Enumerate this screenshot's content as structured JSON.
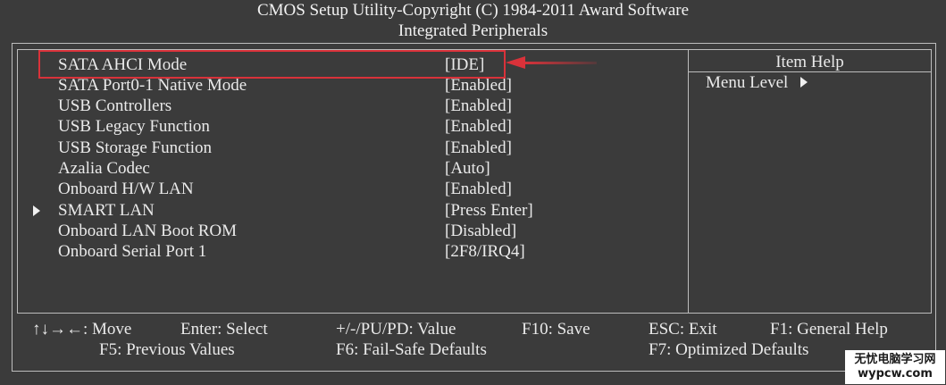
{
  "header": {
    "title_line1": "CMOS Setup Utility-Copyright (C) 1984-2011 Award Software",
    "title_line2": "Integrated Peripherals"
  },
  "settings": [
    {
      "label": "SATA AHCI Mode",
      "value": "[IDE]",
      "submenu": false,
      "highlighted": true
    },
    {
      "label": "SATA Port0-1 Native Mode",
      "value": "[Enabled]",
      "submenu": false
    },
    {
      "label": "USB Controllers",
      "value": "[Enabled]",
      "submenu": false
    },
    {
      "label": "USB Legacy Function",
      "value": "[Enabled]",
      "submenu": false
    },
    {
      "label": "USB Storage Function",
      "value": "[Enabled]",
      "submenu": false
    },
    {
      "label": "Azalia Codec",
      "value": "[Auto]",
      "submenu": false
    },
    {
      "label": "Onboard H/W LAN",
      "value": "[Enabled]",
      "submenu": false
    },
    {
      "label": "SMART LAN",
      "value": "[Press Enter]",
      "submenu": true
    },
    {
      "label": "Onboard LAN Boot ROM",
      "value": "[Disabled]",
      "submenu": false
    },
    {
      "label": "Onboard Serial Port 1",
      "value": "[2F8/IRQ4]",
      "submenu": false
    }
  ],
  "help_panel": {
    "title": "Item Help",
    "menu_level_label": "Menu Level",
    "menu_level_icon": "triangle-right-icon"
  },
  "footer": {
    "move_icon": "↑↓→←",
    "move": ": Move",
    "enter": "Enter: Select",
    "value": "+/-/PU/PD: Value",
    "save": "F10: Save",
    "exit": "ESC: Exit",
    "help": "F1: General Help",
    "previous": "F5: Previous Values",
    "failsafe": "F6: Fail-Safe Defaults",
    "optimized": "F7: Optimized Defaults"
  },
  "watermark": {
    "text": "无忧电脑学习网",
    "url": "wypcw.com"
  },
  "colors": {
    "background": "#3b3b3b",
    "text": "#eaeaea",
    "frame": "#bdbdbd",
    "highlight": "#d9323a"
  }
}
